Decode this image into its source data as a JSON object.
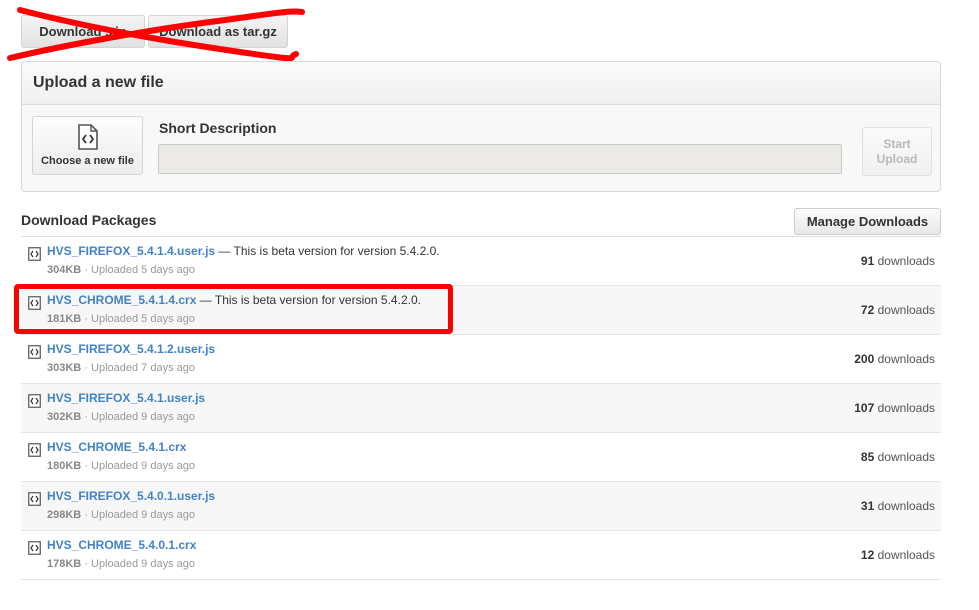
{
  "top_buttons": {
    "download_zip": "Download .zip",
    "download_tar": "Download as tar.gz"
  },
  "upload": {
    "title": "Upload a new file",
    "choose_file": "Choose a new file",
    "short_description_label": "Short Description",
    "short_description_value": "",
    "start_upload": "Start\nUpload"
  },
  "downloads": {
    "title": "Download Packages",
    "manage_button": "Manage Downloads",
    "downloads_word": "downloads",
    "rows": [
      {
        "name": "HVS_FIREFOX_5.4.1.4.user.js",
        "desc": " — This is beta version for version 5.4.2.0.",
        "size": "304KB",
        "uploaded": "Uploaded 5 days ago",
        "count": "91"
      },
      {
        "name": "HVS_CHROME_5.4.1.4.crx",
        "desc": " — This is beta version for version 5.4.2.0.",
        "size": "181KB",
        "uploaded": "Uploaded 5 days ago",
        "count": "72"
      },
      {
        "name": "HVS_FIREFOX_5.4.1.2.user.js",
        "desc": "",
        "size": "303KB",
        "uploaded": "Uploaded 7 days ago",
        "count": "200"
      },
      {
        "name": "HVS_FIREFOX_5.4.1.user.js",
        "desc": "",
        "size": "302KB",
        "uploaded": "Uploaded 9 days ago",
        "count": "107"
      },
      {
        "name": "HVS_CHROME_5.4.1.crx",
        "desc": "",
        "size": "180KB",
        "uploaded": "Uploaded 9 days ago",
        "count": "85"
      },
      {
        "name": "HVS_FIREFOX_5.4.0.1.user.js",
        "desc": "",
        "size": "298KB",
        "uploaded": "Uploaded 9 days ago",
        "count": "31"
      },
      {
        "name": "HVS_CHROME_5.4.0.1.crx",
        "desc": "",
        "size": "178KB",
        "uploaded": "Uploaded 9 days ago",
        "count": "12"
      }
    ]
  },
  "colors": {
    "link": "#4183c4",
    "annotation_red": "#ff0000"
  }
}
